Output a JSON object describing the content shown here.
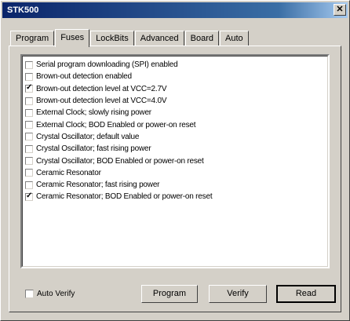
{
  "window": {
    "title": "STK500",
    "close_glyph": "✕"
  },
  "tabs": [
    {
      "label": "Program",
      "active": false
    },
    {
      "label": "Fuses",
      "active": true
    },
    {
      "label": "LockBits",
      "active": false
    },
    {
      "label": "Advanced",
      "active": false
    },
    {
      "label": "Board",
      "active": false
    },
    {
      "label": "Auto",
      "active": false
    }
  ],
  "fuses": [
    {
      "label": "Serial program downloading (SPI) enabled",
      "checked": false
    },
    {
      "label": "Brown-out detection enabled",
      "checked": false
    },
    {
      "label": "Brown-out detection level at VCC=2.7V",
      "checked": true
    },
    {
      "label": "Brown-out detection level at VCC=4.0V",
      "checked": false
    },
    {
      "label": "External Clock; slowly rising power",
      "checked": false
    },
    {
      "label": "External Clock; BOD Enabled or power-on reset",
      "checked": false
    },
    {
      "label": "Crystal Oscillator; default value",
      "checked": false
    },
    {
      "label": "Crystal Oscillator; fast rising power",
      "checked": false
    },
    {
      "label": "Crystal Oscillator; BOD Enabled or power-on reset",
      "checked": false
    },
    {
      "label": "Ceramic Resonator",
      "checked": false
    },
    {
      "label": "Ceramic Resonator; fast rising power",
      "checked": false
    },
    {
      "label": "Ceramic Resonator; BOD Enabled or power-on reset",
      "checked": true
    }
  ],
  "footer": {
    "auto_verify_label": "Auto Verify",
    "auto_verify_checked": false,
    "program_label": "Program",
    "verify_label": "Verify",
    "read_label": "Read"
  }
}
